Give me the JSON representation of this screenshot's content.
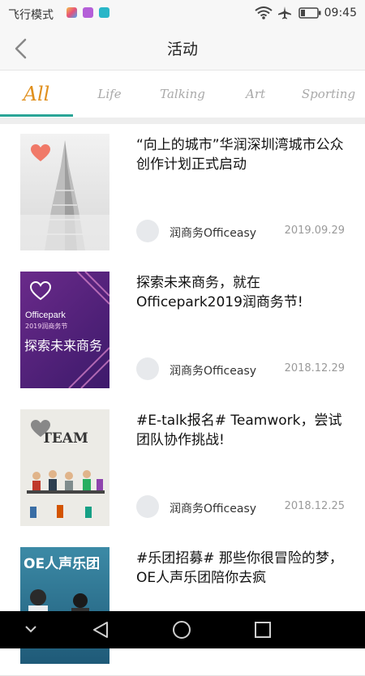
{
  "status": {
    "mode": "飞行模式",
    "time": "09:45"
  },
  "header": {
    "title": "活动"
  },
  "tabs": [
    {
      "label": "All",
      "active": true
    },
    {
      "label": "Life",
      "active": false
    },
    {
      "label": "Talking",
      "active": false
    },
    {
      "label": "Art",
      "active": false
    },
    {
      "label": "Sporting",
      "active": false
    }
  ],
  "cards": [
    {
      "title": "“向上的城市”华润深圳湾城市公众创作计划正式启动",
      "author": "润商务Officeasy",
      "date": "2019.09.29",
      "liked": true
    },
    {
      "title": "探索未来商务，就在Officepark2019润商务节!",
      "author": "润商务Officeasy",
      "date": "2018.12.29",
      "liked": false,
      "image_text": {
        "brand": "Officepark",
        "sub": "2019润商务节",
        "main": "探索未来商务"
      }
    },
    {
      "title": "#E-talk报名# Teamwork，尝试团队协作挑战!",
      "author": "润商务Officeasy",
      "date": "2018.12.25",
      "liked": false,
      "image_text": {
        "main": "TEAM"
      }
    },
    {
      "title": "#乐团招募# 那些你很冒险的梦，OE人声乐团陪你去疯",
      "author": "",
      "date": "",
      "liked": false,
      "image_text": {
        "main": "OE人声乐团"
      }
    }
  ],
  "colors": {
    "accent": "#e0901e",
    "tab_underline": "#2aa597",
    "liked_heart": "#f07968"
  }
}
